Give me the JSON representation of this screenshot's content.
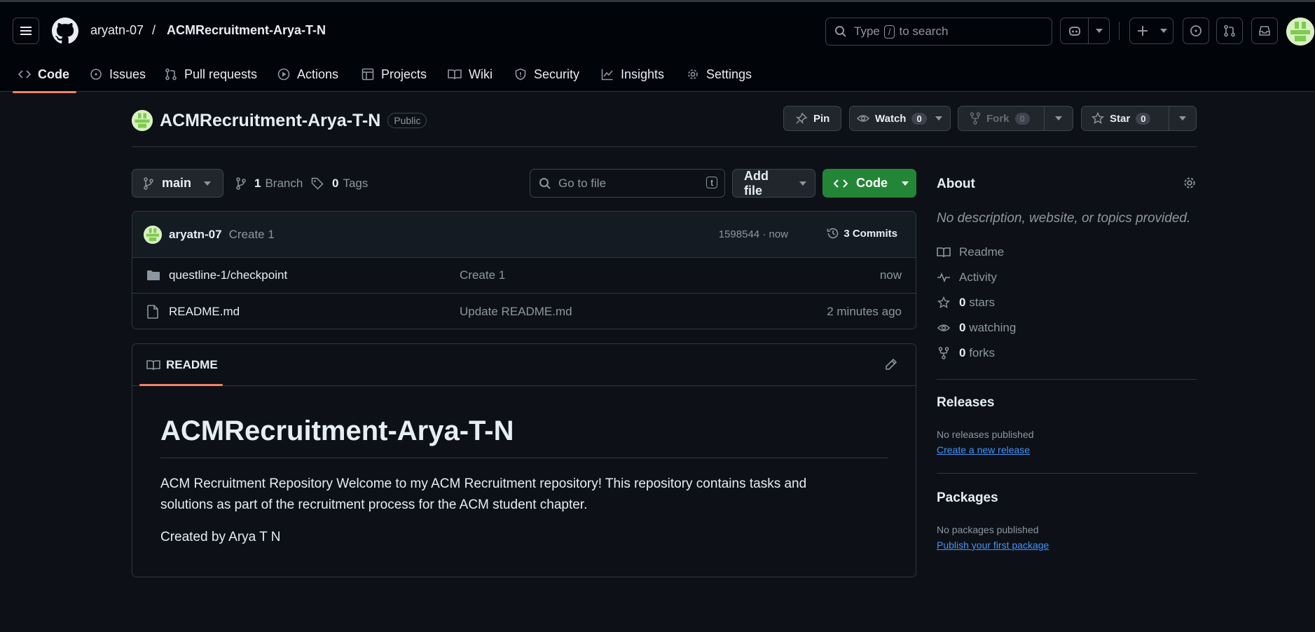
{
  "header": {
    "owner": "aryatn-07",
    "separator": "/",
    "repo": "ACMRecruitment-Arya-T-N",
    "search_prefix": "Type",
    "search_key": "/",
    "search_suffix": "to search"
  },
  "tabs": [
    {
      "label": "Code",
      "icon": "code-icon"
    },
    {
      "label": "Issues",
      "icon": "issue-icon"
    },
    {
      "label": "Pull requests",
      "icon": "pull-request-icon"
    },
    {
      "label": "Actions",
      "icon": "play-icon"
    },
    {
      "label": "Projects",
      "icon": "table-icon"
    },
    {
      "label": "Wiki",
      "icon": "book-icon"
    },
    {
      "label": "Security",
      "icon": "shield-icon"
    },
    {
      "label": "Insights",
      "icon": "graph-icon"
    },
    {
      "label": "Settings",
      "icon": "gear-icon"
    }
  ],
  "repo_head": {
    "name": "ACMRecruitment-Arya-T-N",
    "visibility": "Public",
    "pin": "Pin",
    "watch": "Watch",
    "watch_count": "0",
    "fork": "Fork",
    "fork_count": "0",
    "star": "Star",
    "star_count": "0"
  },
  "file_nav": {
    "branch": "main",
    "branch_count": "1",
    "branch_label": "Branch",
    "tag_count": "0",
    "tag_label": "Tags",
    "goto_placeholder": "Go to file",
    "goto_key": "t",
    "add_file": "Add file",
    "code": "Code"
  },
  "commit": {
    "author": "aryatn-07",
    "message": "Create 1",
    "meta": "1598544 · now",
    "commits": "3 Commits"
  },
  "files": [
    {
      "name": "questline-1/checkpoint",
      "message": "Create 1",
      "time": "now",
      "type": "folder"
    },
    {
      "name": "README.md",
      "message": "Update README.md",
      "time": "2 minutes ago",
      "type": "file"
    }
  ],
  "readme": {
    "tab": "README",
    "title": "ACMRecruitment-Arya-T-N",
    "paragraph": "ACM Recruitment Repository Welcome to my ACM Recruitment repository! This repository contains tasks and solutions as part of the recruitment process for the ACM student chapter.",
    "created_by": "Created by Arya T N"
  },
  "about": {
    "heading": "About",
    "description": "No description, website, or topics provided.",
    "readme": "Readme",
    "activity": "Activity",
    "stars_count": "0",
    "stars_label": "stars",
    "watching_count": "0",
    "watching_label": "watching",
    "forks_count": "0",
    "forks_label": "forks"
  },
  "releases": {
    "heading": "Releases",
    "empty": "No releases published",
    "link": "Create a new release"
  },
  "packages": {
    "heading": "Packages",
    "empty": "No packages published",
    "link": "Publish your first package"
  },
  "colors": {
    "background": "#0d1117",
    "header": "#010409",
    "accent_underline": "#f78166",
    "primary_button": "#238636",
    "link": "#4493f8"
  }
}
